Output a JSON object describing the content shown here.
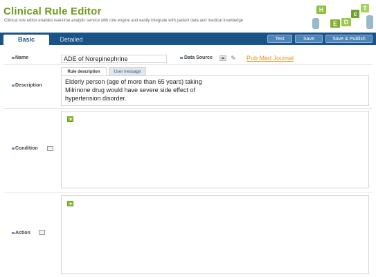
{
  "header": {
    "title": "Clinical Rule Editor",
    "subtitle": "Clinical rule editor enables real-time analytic service with rule engine and easily integrate with patient data and medical knowledge",
    "logo": {
      "letters": [
        "H",
        "E",
        "D",
        "c",
        "T"
      ]
    }
  },
  "tabs": {
    "basic": "Basic",
    "detailed": "Detailed"
  },
  "toolbar": {
    "test": "Test",
    "save": "Save",
    "save_publish": "Save & Publish"
  },
  "form": {
    "name_label": "Name",
    "name_value": "ADE of Norepinephrine",
    "data_source_label": "Data Source",
    "data_source_link": "Pub Med Journal",
    "description_label": "Description",
    "description_tabs": {
      "rule_description": "Rule description",
      "user_message": "User message"
    },
    "description_lines": [
      "Elderly person (age of more than 65 years) taking",
      "Milrinone drug  would have severe side effect of",
      "hypertension disorder."
    ],
    "condition_label": "Condition",
    "action_label": "Action"
  },
  "colors": {
    "title": "#6f9a1e",
    "tabbar": "#1a5386",
    "link": "#e6931e",
    "add": "#8bbf3c"
  },
  "icons": [
    "bullet-icon",
    "data-source-icon",
    "attachment-icon",
    "add-icon",
    "info-icon"
  ]
}
